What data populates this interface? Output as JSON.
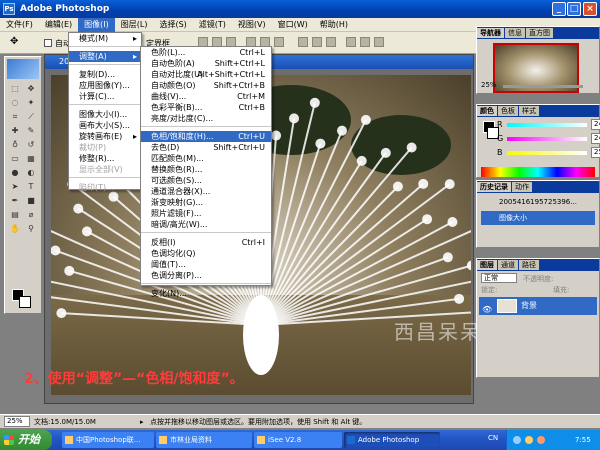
{
  "window": {
    "title": "Adobe Photoshop"
  },
  "menubar": [
    {
      "label": "文件(F)"
    },
    {
      "label": "编辑(E)"
    },
    {
      "label": "图像(I)",
      "active": true
    },
    {
      "label": "图层(L)"
    },
    {
      "label": "选择(S)"
    },
    {
      "label": "滤镜(T)"
    },
    {
      "label": "视图(V)"
    },
    {
      "label": "窗口(W)"
    },
    {
      "label": "帮助(H)"
    }
  ],
  "options": {
    "auto_select": "自动",
    "transform": "定界框"
  },
  "document": {
    "title": "20..."
  },
  "image_menu": [
    {
      "label": "模式(M)",
      "sub": true
    },
    {
      "sep": true
    },
    {
      "label": "调整(A)",
      "sub": true,
      "hl": true
    },
    {
      "sep": true
    },
    {
      "label": "复制(D)..."
    },
    {
      "label": "应用图像(Y)..."
    },
    {
      "label": "计算(C)..."
    },
    {
      "sep": true
    },
    {
      "label": "图像大小(I)..."
    },
    {
      "label": "画布大小(S)..."
    },
    {
      "label": "旋转画布(E)",
      "sub": true
    },
    {
      "label": "裁切(P)",
      "dis": true
    },
    {
      "label": "修整(R)..."
    },
    {
      "label": "显示全部(V)",
      "dis": true
    },
    {
      "sep": true
    },
    {
      "label": "陷印(T)...",
      "dis": true
    }
  ],
  "adjust_menu": [
    {
      "label": "色阶(L)...",
      "sc": "Ctrl+L"
    },
    {
      "label": "自动色阶(A)",
      "sc": "Shift+Ctrl+L"
    },
    {
      "label": "自动对比度(U)",
      "sc": "Alt+Shift+Ctrl+L"
    },
    {
      "label": "自动颜色(O)",
      "sc": "Shift+Ctrl+B"
    },
    {
      "label": "曲线(V)...",
      "sc": "Ctrl+M"
    },
    {
      "label": "色彩平衡(B)...",
      "sc": "Ctrl+B"
    },
    {
      "label": "亮度/对比度(C)...",
      "sc": ""
    },
    {
      "sep": true
    },
    {
      "label": "色相/饱和度(H)...",
      "sc": "Ctrl+U",
      "hl": true
    },
    {
      "label": "去色(D)",
      "sc": "Shift+Ctrl+U"
    },
    {
      "label": "匹配颜色(M)...",
      "sc": ""
    },
    {
      "label": "替换颜色(R)...",
      "sc": ""
    },
    {
      "label": "可选颜色(S)...",
      "sc": ""
    },
    {
      "label": "通道混合器(X)...",
      "sc": ""
    },
    {
      "label": "渐变映射(G)...",
      "sc": ""
    },
    {
      "label": "照片滤镜(F)...",
      "sc": ""
    },
    {
      "label": "暗调/高光(W)...",
      "sc": ""
    },
    {
      "sep": true
    },
    {
      "label": "反相(I)",
      "sc": "Ctrl+I"
    },
    {
      "label": "色调均化(Q)",
      "sc": ""
    },
    {
      "label": "阈值(T)...",
      "sc": ""
    },
    {
      "label": "色调分离(P)...",
      "sc": ""
    },
    {
      "sep": true
    },
    {
      "label": "变化(N)...",
      "sc": ""
    }
  ],
  "panels": {
    "navigator": {
      "tabs": [
        "导航器",
        "信息",
        "直方图"
      ],
      "zoom": "25%"
    },
    "color": {
      "tabs": [
        "颜色",
        "色板",
        "样式"
      ],
      "channels": [
        {
          "name": "R",
          "value": "249"
        },
        {
          "name": "G",
          "value": "249"
        },
        {
          "name": "B",
          "value": "252"
        }
      ]
    },
    "history": {
      "tabs": [
        "历史记录",
        "动作"
      ],
      "items": [
        "2005416195725396...",
        "图像大小"
      ]
    },
    "layers": {
      "tabs": [
        "图层",
        "通道",
        "路径"
      ],
      "blend": "正常",
      "opacity_label": "不透明度:",
      "fill_label": "填充:",
      "lock_label": "锁定:",
      "layer_name": "背景"
    }
  },
  "caption": "2、使用“调整”—“色相/饱和度”。",
  "watermark": "西昌呆呆虎",
  "status": {
    "zoom": "25%",
    "doc": "文档:15.0M/15.0M",
    "hint": "点按并拖移以移动图层或选区。要用附加选项，使用 Shift 和 Alt 键。"
  },
  "taskbar": {
    "start": "开始",
    "tasks": [
      {
        "label": "中国Photoshop联..."
      },
      {
        "label": "市林业局资料"
      },
      {
        "label": "iSee V2.8"
      },
      {
        "label": "Adobe Photoshop",
        "active": true
      }
    ],
    "lang": "CN",
    "time": "7:55"
  }
}
